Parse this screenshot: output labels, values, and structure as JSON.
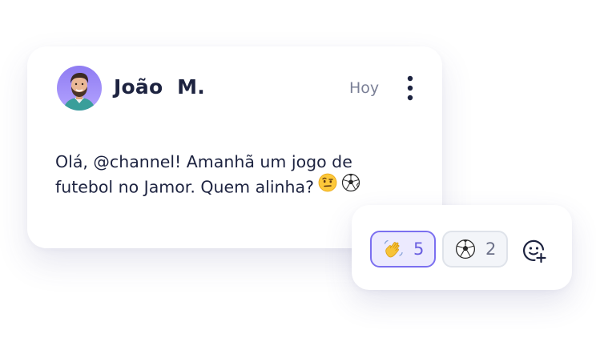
{
  "message": {
    "author": "João  M.",
    "time": "Hoy",
    "text_line1": "Olá, @channel! Amanhã um jogo de",
    "text_line2": "futebol no Jamor. Quem alinha?",
    "inline_emojis": [
      "face-with-raised-eyebrow",
      "soccer-ball"
    ]
  },
  "reactions": [
    {
      "emoji": "waving-hand",
      "count": "5",
      "selected": true
    },
    {
      "emoji": "soccer-ball",
      "count": "2",
      "selected": false
    }
  ],
  "colors": {
    "accent": "#7b6ff0",
    "text": "#1d2340",
    "muted": "#7a7f96"
  }
}
